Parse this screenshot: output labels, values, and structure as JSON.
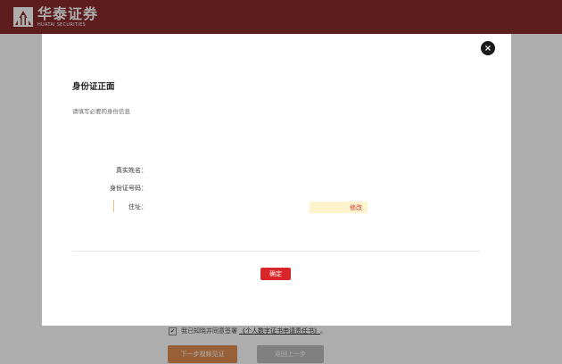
{
  "header": {
    "logo_cn": "华泰证券",
    "logo_en": "HUATAI SECURITIES",
    "logo_icon": "huatai-logo-icon",
    "bg_color": "#8a2a2d"
  },
  "page": {
    "agree_text": "我已知晓并同意签署",
    "agree_link": "《个人数字证书申请责任书》",
    "agree_suffix": "。",
    "agree_checkmark": "✔",
    "next_button": "下一步视频见证",
    "prev_button": "返回上一步"
  },
  "modal": {
    "close_icon": "×",
    "title": "身份证正面",
    "subtitle": "请填写必要的身份信息",
    "fields": {
      "name_label": "真实姓名：",
      "id_label": "身份证号码：",
      "address_label": "住址："
    },
    "address_value": "",
    "modify_button": "修改",
    "confirm_button": "确定",
    "accent_color": "#d9262a"
  }
}
